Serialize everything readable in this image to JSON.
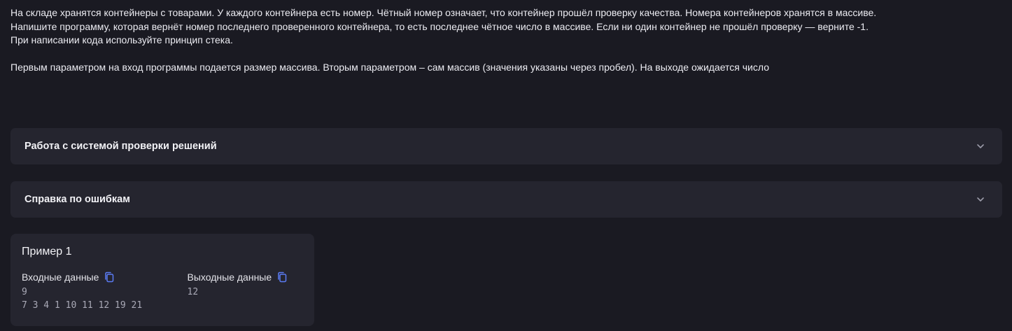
{
  "task": {
    "paragraphs": [
      "На складе хранятся контейнеры с товарами. У каждого контейнера есть номер. Чётный номер означает, что контейнер прошёл проверку качества. Номера контейнеров хранятся в массиве.",
      "Напишите программу, которая вернёт номер последнего проверенного контейнера, то есть последнее чётное число в массиве. Если ни один контейнер не прошёл проверку — верните -1.",
      "При написании кода используйте принцип стека.",
      "Первым параметром на вход программы подается размер массива. Вторым параметром – сам массив (значения указаны через пробел). На выходе ожидается число"
    ]
  },
  "accordions": [
    {
      "title": "Работа с системой проверки решений",
      "icon": "chevron-down-icon"
    },
    {
      "title": "Справка по ошибкам",
      "icon": "chevron-down-icon"
    }
  ],
  "example": {
    "title": "Пример 1",
    "input_label": "Входные данные",
    "output_label": "Выходные данные",
    "input_lines": [
      "9",
      "7 3 4 1 10 11 12 19 21"
    ],
    "output_lines": [
      "12"
    ],
    "copy_icon": "copy-icon"
  },
  "colors": {
    "background": "#1a1a22",
    "panel": "#25252f",
    "accent": "#5b7cf5"
  }
}
